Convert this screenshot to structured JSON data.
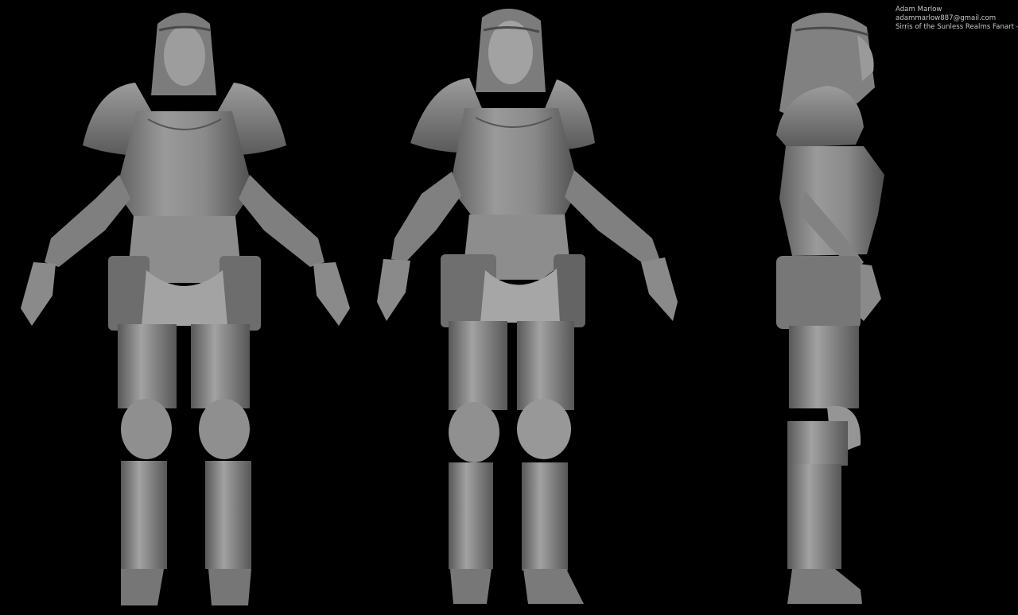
{
  "credits": {
    "name": "Adam Marlow",
    "email": "adammarlow887@gmail.com",
    "title": "Sirris of the Sunless Realms Fanart - WIP"
  },
  "scene": {
    "background": "#000000",
    "sculpt_color": "#8e8e8e",
    "views": [
      "front",
      "three-quarter",
      "side"
    ]
  }
}
